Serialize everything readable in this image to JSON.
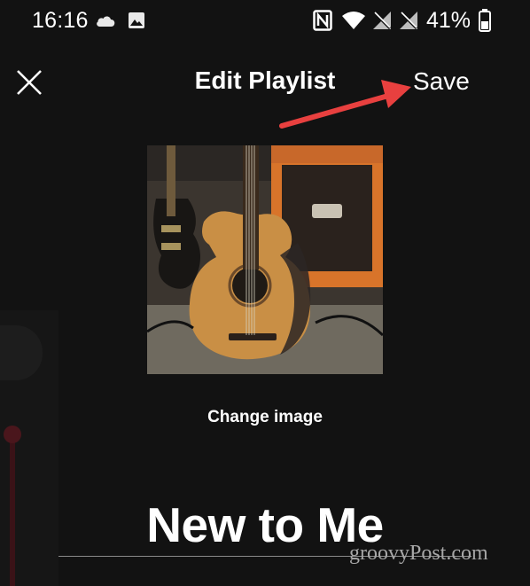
{
  "status_bar": {
    "time": "16:16",
    "battery_percent": "41%",
    "icons": [
      "cloud-icon",
      "image-icon",
      "nfc-icon",
      "wifi-icon",
      "no-signal-icon",
      "no-signal-icon",
      "battery-icon"
    ]
  },
  "header": {
    "title": "Edit Playlist",
    "save_label": "Save",
    "close_icon": "close-icon"
  },
  "annotation": {
    "arrow_color": "#e8403f"
  },
  "cover": {
    "change_image_label": "Change image"
  },
  "playlist": {
    "name": "New to Me"
  },
  "watermark": "groovyPost.com",
  "colors": {
    "background": "#121212",
    "text": "#ffffff",
    "arrow": "#e8403f",
    "watermark": "#a7a7a7"
  }
}
